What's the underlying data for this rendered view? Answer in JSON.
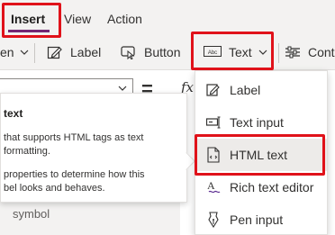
{
  "menu": {
    "tabs": [
      {
        "label": "Insert"
      },
      {
        "label": "View"
      },
      {
        "label": "Action"
      }
    ]
  },
  "ribbon": {
    "partial_left": "en",
    "label_button": "Label",
    "button_button": "Button",
    "text_button": "Text",
    "text_icon_text": "Abc",
    "controls_partial": "Contr"
  },
  "formula": {
    "equals": "=",
    "fx": "fx"
  },
  "tooltip": {
    "title": "text",
    "lines": [
      "that supports HTML tags as text",
      "formatting.",
      "properties to determine how this",
      "bel looks and behaves."
    ]
  },
  "canvas": {
    "bottom_text": "symbol"
  },
  "dropdown": {
    "items": [
      {
        "label": "Label",
        "icon": "edit-pencil-icon"
      },
      {
        "label": "Text input",
        "icon": "text-input-icon"
      },
      {
        "label": "HTML text",
        "icon": "html-document-icon",
        "selected": true
      },
      {
        "label": "Rich text editor",
        "icon": "rich-text-icon"
      },
      {
        "label": "Pen input",
        "icon": "pen-nib-icon"
      }
    ]
  },
  "colors": {
    "accent": "#742774",
    "highlight": "#e0121a",
    "ribbon_bg": "#f3f2f1"
  }
}
